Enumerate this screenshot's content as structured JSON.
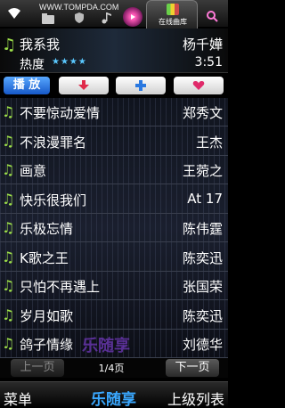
{
  "statusbar": {
    "watermark": "WWW.TOMPDA.COM",
    "online_label": "在线曲库",
    "icons": [
      "wifi-icon",
      "folder-icon",
      "shield-icon",
      "note-icon",
      "play-icon",
      "online-library-icon",
      "search-icon"
    ]
  },
  "now_playing": {
    "title": "我系我",
    "artist": "杨千嬅",
    "heat_label": "热度",
    "stars": "★★★★",
    "time": "3:51"
  },
  "buttons": {
    "play": "播 放",
    "download_icon": "↓",
    "add_icon": "+",
    "favorite_icon": "♥"
  },
  "songs": [
    {
      "title": "不要惊动爱情",
      "artist": "郑秀文"
    },
    {
      "title": "不浪漫罪名",
      "artist": "王杰"
    },
    {
      "title": "画意",
      "artist": "王菀之"
    },
    {
      "title": "快乐很我们",
      "artist": "At 17"
    },
    {
      "title": "乐极忘情",
      "artist": "陈伟霆"
    },
    {
      "title": "K歌之王",
      "artist": "陈奕迅"
    },
    {
      "title": "只怕不再遇上",
      "artist": "张国荣"
    },
    {
      "title": "岁月如歌",
      "artist": "陈奕迅"
    },
    {
      "title": "鸽子情缘",
      "artist": "刘德华"
    }
  ],
  "list_watermark": "乐随享",
  "pager": {
    "prev": "上一页",
    "info": "1/4页",
    "next": "下一页"
  },
  "bottombar": {
    "menu": "菜单",
    "center": "乐随享",
    "back": "上级列表"
  },
  "colors": {
    "accent": "#3aa8ff",
    "note_green": "#9ee04a"
  }
}
